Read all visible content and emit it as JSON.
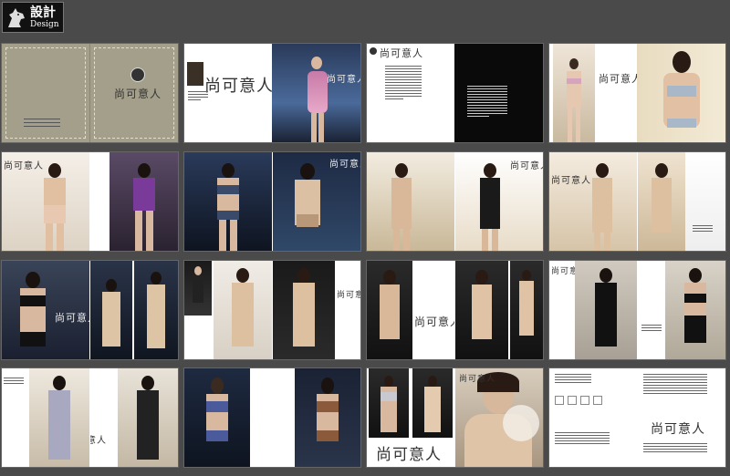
{
  "logo": {
    "cn": "設計",
    "en": "Design",
    "icon": "horse-head-icon"
  },
  "brand": {
    "name": "尚可意人"
  }
}
